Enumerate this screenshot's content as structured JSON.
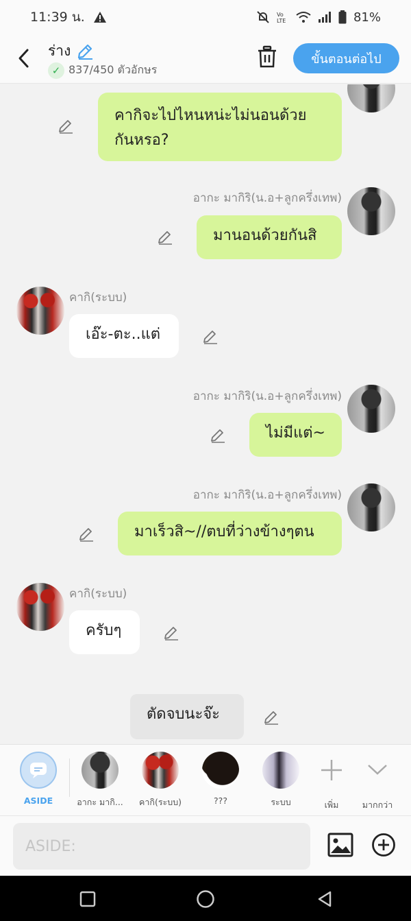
{
  "status_bar": {
    "time": "11:39 น.",
    "battery": "81%"
  },
  "header": {
    "title": "ร่าง",
    "char_count": "837/450 ตัวอักษร",
    "next_label": "ขั้นตอนต่อไป"
  },
  "messages": [
    {
      "side": "right",
      "sender": "",
      "text": "คากิจะไปไหนหน่ะไม่นอนด้วย\nกันหรอ?"
    },
    {
      "side": "right",
      "sender": "อากะ มากิริ(น.อ+ลูกครึ่งเทพ)",
      "text": "มานอนด้วยกันสิ"
    },
    {
      "side": "left",
      "sender": "คากิ(ระบบ)",
      "text": "เอ๊ะ-ตะ..แต่"
    },
    {
      "side": "right",
      "sender": "อากะ มากิริ(น.อ+ลูกครึ่งเทพ)",
      "text": "ไม่มีแต่~"
    },
    {
      "side": "right",
      "sender": "อากะ มากิริ(น.อ+ลูกครึ่งเทพ)",
      "text": "มาเร็วสิ~//ตบที่ว่างข้างๆตน"
    },
    {
      "side": "left",
      "sender": "คากิ(ระบบ)",
      "text": "ครับๆ"
    },
    {
      "side": "center",
      "sender": "",
      "text": "ตัดจบนะจ๊ะ"
    }
  ],
  "characters": [
    {
      "label": "ASIDE",
      "icon": "chat-bubble-icon"
    },
    {
      "label": "อากะ มากิ..."
    },
    {
      "label": "คากิ(ระบบ)"
    },
    {
      "label": "???"
    },
    {
      "label": "ระบบ"
    },
    {
      "label": "เพิ่ม",
      "icon": "plus-icon"
    },
    {
      "label": "มากกว่า",
      "icon": "chevron-down-icon"
    }
  ],
  "input": {
    "placeholder": "ASIDE:"
  },
  "colors": {
    "accent": "#4aa3ee",
    "bubble_right": "#d7f59a",
    "bubble_left": "#ffffff",
    "aside_label": "#4aa3ee"
  }
}
